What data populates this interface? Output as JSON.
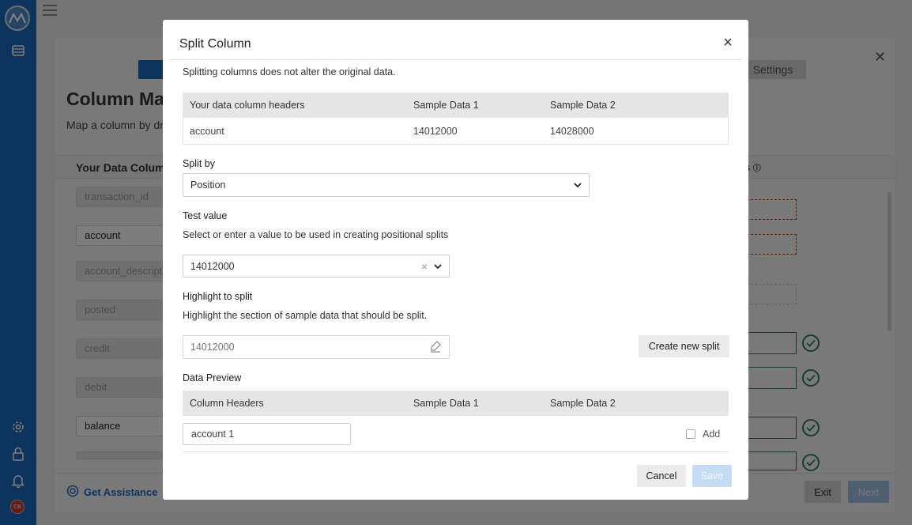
{
  "nav": {
    "icons": [
      "logo-icon",
      "table-icon",
      "gear-icon",
      "lock-icon",
      "bell-icon"
    ],
    "avatar_initials": "CB"
  },
  "background": {
    "title": "Column Map",
    "subtitle": "Map a column by dr",
    "settings_label": "Settings",
    "left_header": "Your Data Colum",
    "right_header": "ns",
    "fields": [
      "transaction_id",
      "account",
      "account_descriptio",
      "posted",
      "credit",
      "debit",
      "balance"
    ],
    "assistance_label": "Get Assistance",
    "exit_label": "Exit",
    "next_label": "Next"
  },
  "modal": {
    "title": "Split Column",
    "note": "Splitting columns does not alter the original data.",
    "source_table": {
      "headers": [
        "Your data column headers",
        "Sample Data 1",
        "Sample Data 2"
      ],
      "row": [
        "account",
        "14012000",
        "14028000"
      ]
    },
    "split_by": {
      "label": "Split by",
      "value": "Position"
    },
    "test_value": {
      "label": "Test value",
      "helper": "Select or enter a value to be used in creating positional splits",
      "value": "14012000"
    },
    "highlight": {
      "label": "Highlight to split",
      "helper": "Highlight the section of sample data that should be split.",
      "value": "14012000",
      "create_button": "Create new split"
    },
    "preview": {
      "label": "Data Preview",
      "headers": [
        "Column Headers",
        "Sample Data 1",
        "Sample Data 2"
      ],
      "row_input": "account 1",
      "add_label": "Add"
    },
    "cancel_label": "Cancel",
    "save_label": "Save"
  },
  "colors": {
    "brand_blue": "#1d67b9",
    "success_green": "#2e7d5b",
    "error_red": "#c0392b",
    "save_disabled": "#c5dcf4"
  }
}
